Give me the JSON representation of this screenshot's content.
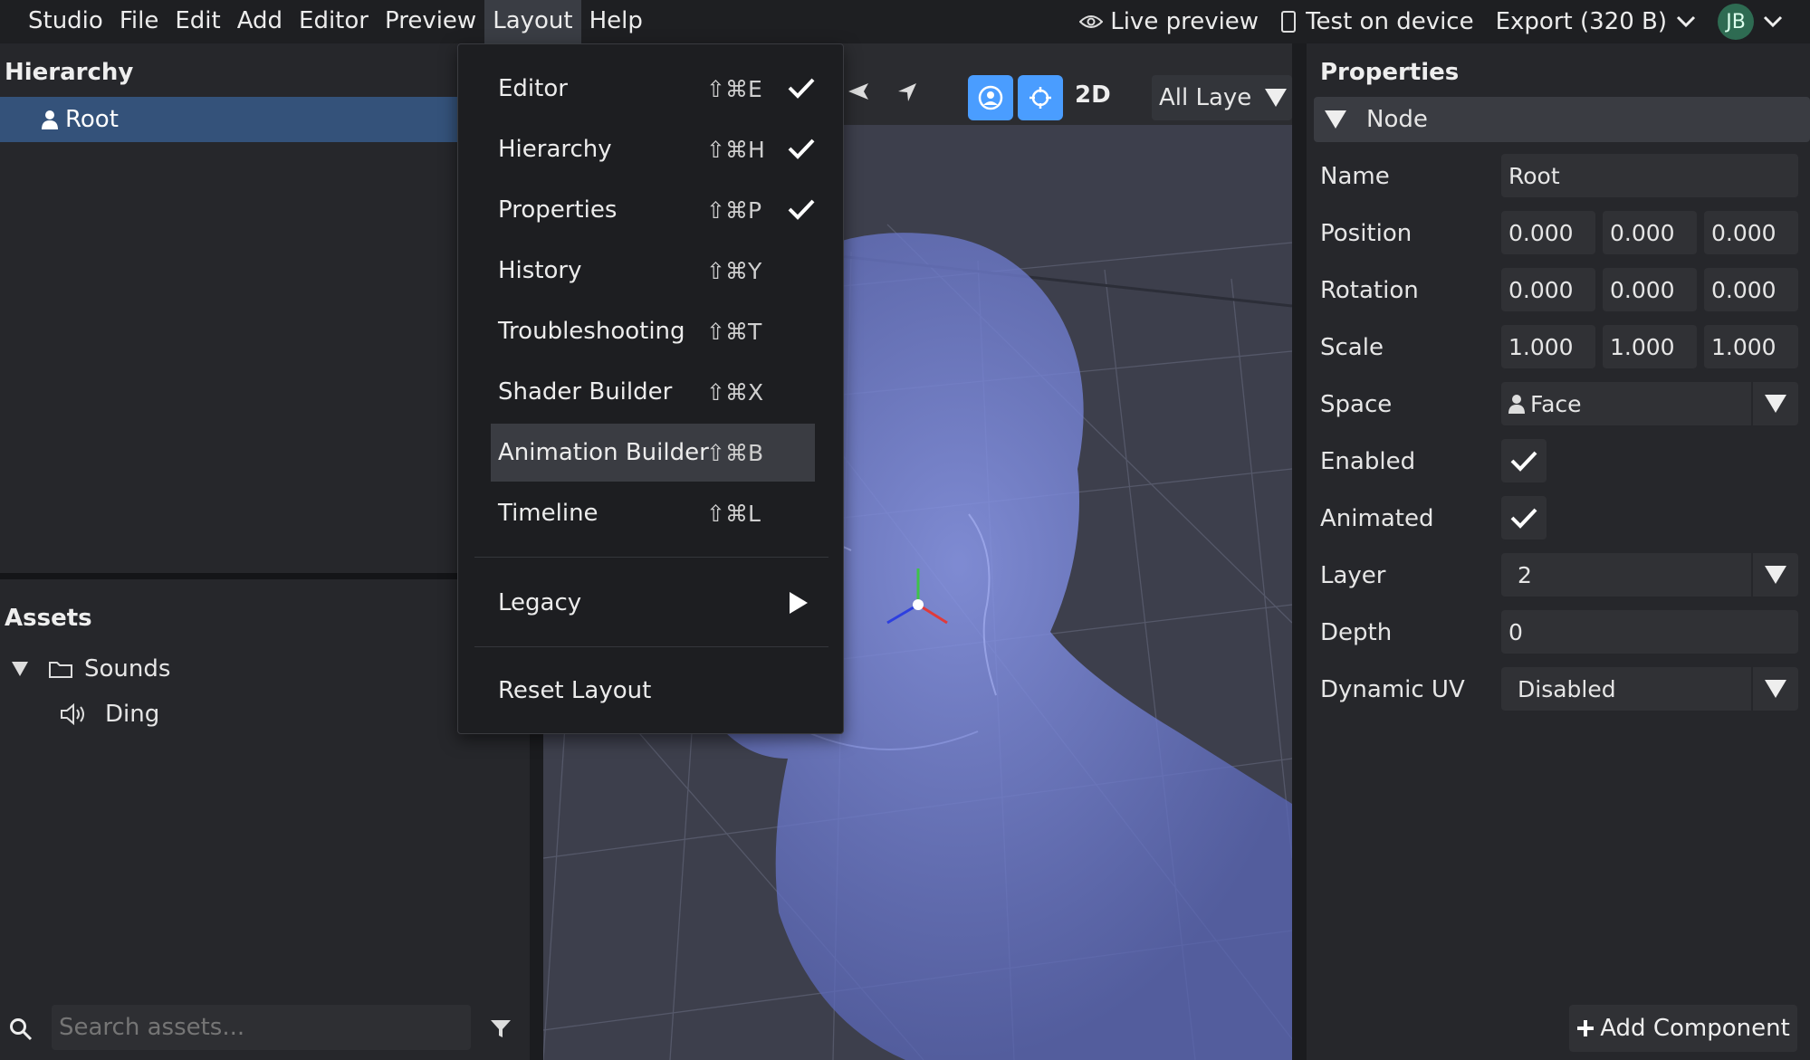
{
  "menubar": {
    "items": [
      "Studio",
      "File",
      "Edit",
      "Add",
      "Editor",
      "Preview",
      "Layout",
      "Help"
    ],
    "open_item": "Layout",
    "live_preview": "Live preview",
    "test_on_device": "Test on device",
    "export": "Export (320 B)",
    "avatar_initials": "JB"
  },
  "hierarchy": {
    "title": "Hierarchy",
    "root_label": "Root"
  },
  "assets": {
    "title": "Assets",
    "folder": "Sounds",
    "file": "Ding",
    "search_placeholder": "Search assets..."
  },
  "viewport": {
    "mode_2d": "2D",
    "layers_select": "All Laye"
  },
  "layout_menu": {
    "items": [
      {
        "label": "Editor",
        "shortcut": "⇧⌘E",
        "checked": true
      },
      {
        "label": "Hierarchy",
        "shortcut": "⇧⌘H",
        "checked": true
      },
      {
        "label": "Properties",
        "shortcut": "⇧⌘P",
        "checked": true
      },
      {
        "label": "History",
        "shortcut": "⇧⌘Y",
        "checked": false
      },
      {
        "label": "Troubleshooting",
        "shortcut": "⇧⌘T",
        "checked": false
      },
      {
        "label": "Shader Builder",
        "shortcut": "⇧⌘X",
        "checked": false
      },
      {
        "label": "Animation Builder",
        "shortcut": "⇧⌘B",
        "checked": false
      },
      {
        "label": "Timeline",
        "shortcut": "⇧⌘L",
        "checked": false
      }
    ],
    "highlighted": "Animation Builder",
    "legacy": "Legacy",
    "reset": "Reset Layout"
  },
  "properties": {
    "title": "Properties",
    "section": "Node",
    "labels": {
      "name": "Name",
      "position": "Position",
      "rotation": "Rotation",
      "scale": "Scale",
      "space": "Space",
      "enabled": "Enabled",
      "animated": "Animated",
      "layer": "Layer",
      "depth": "Depth",
      "dynamic_uv": "Dynamic UV"
    },
    "name_value": "Root",
    "position": [
      "0.000",
      "0.000",
      "0.000"
    ],
    "rotation": [
      "0.000",
      "0.000",
      "0.000"
    ],
    "scale": [
      "1.000",
      "1.000",
      "1.000"
    ],
    "space_value": "Face",
    "layer_value": "2",
    "depth_value": "0",
    "dynamic_uv_value": "Disabled",
    "add_component": "Add Component"
  },
  "colors": {
    "accent_blue": "#4a9dff",
    "selection": "#34527a",
    "head_tint": "#6a78d0"
  }
}
